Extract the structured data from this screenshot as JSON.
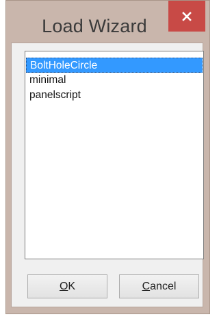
{
  "window": {
    "title": "Load Wizard"
  },
  "list": {
    "items": [
      {
        "label": "BoltHoleCircle",
        "selected": true
      },
      {
        "label": "minimal",
        "selected": false
      },
      {
        "label": "panelscript",
        "selected": false
      }
    ]
  },
  "buttons": {
    "ok": {
      "mnemonic": "O",
      "rest": "K"
    },
    "cancel": {
      "mnemonic": "C",
      "rest": "ancel"
    }
  },
  "colors": {
    "frame": "#c9b6ac",
    "close_button": "#c84a46",
    "selection": "#3399ff",
    "client": "#f0f0f0"
  },
  "icons": {
    "close": "close-icon"
  }
}
